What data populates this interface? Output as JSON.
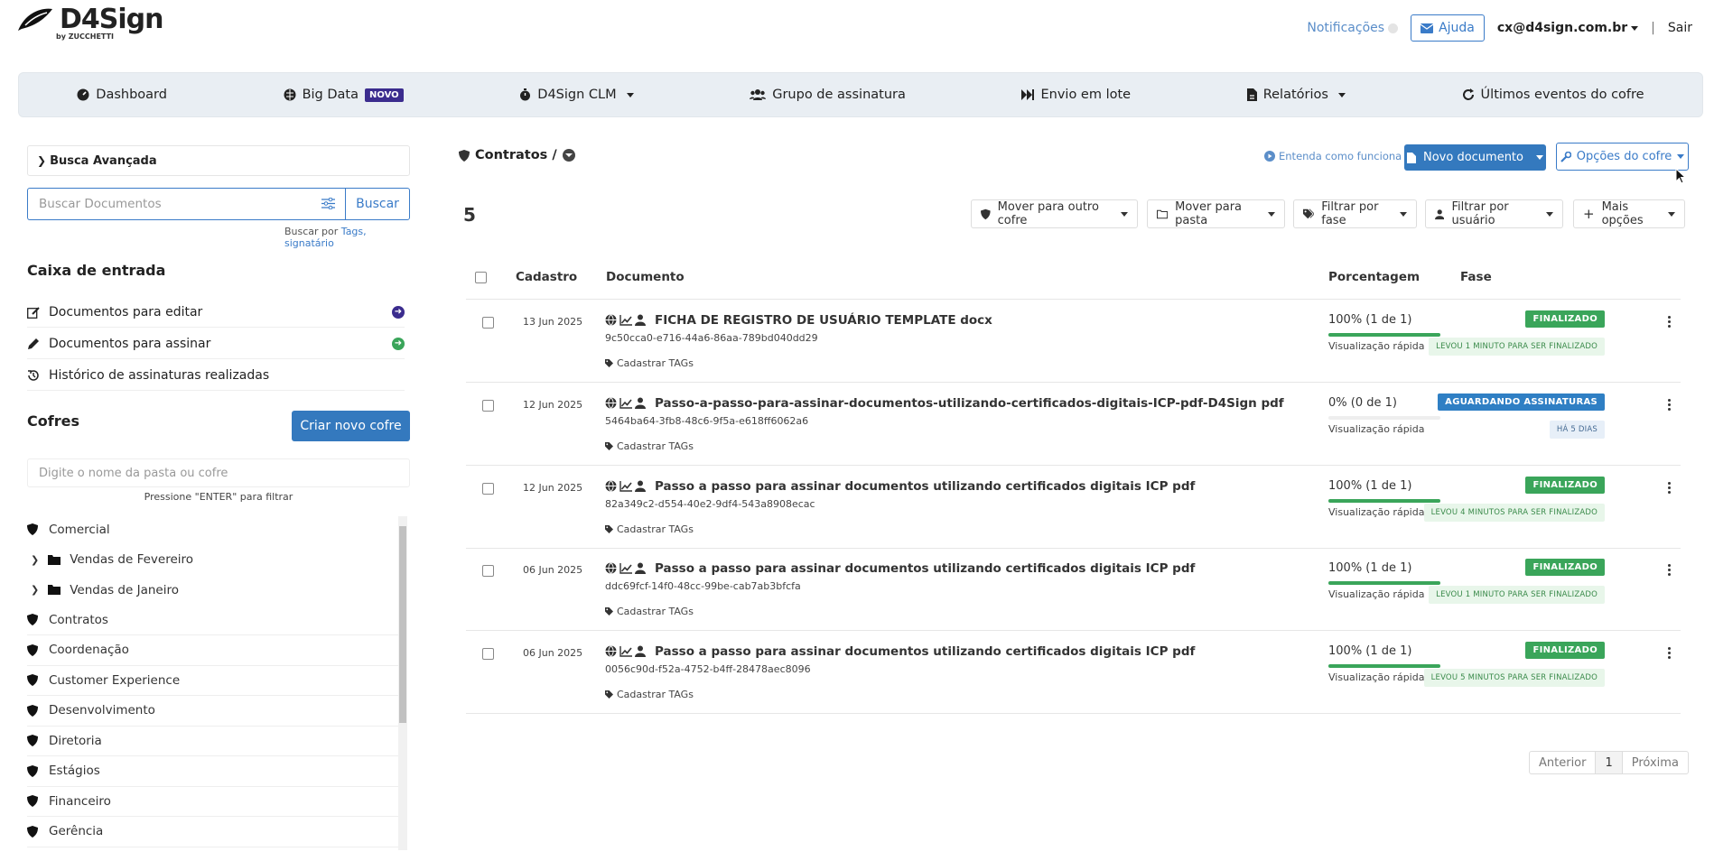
{
  "brand": {
    "name": "D4Sign",
    "sub": "by ZUCCHETTI"
  },
  "header": {
    "notifications_label": "Notificações",
    "help_label": "Ajuda",
    "user_email": "cx@d4sign.com.br",
    "separator": "|",
    "logout_label": "Sair"
  },
  "nav": {
    "items": [
      {
        "label": "Dashboard",
        "icon": "dashboard-icon"
      },
      {
        "label": "Big Data",
        "icon": "brain-icon",
        "badge": "NOVO"
      },
      {
        "label": "D4Sign CLM",
        "icon": "stopwatch-icon",
        "dropdown": true
      },
      {
        "label": "Grupo de assinatura",
        "icon": "users-icon"
      },
      {
        "label": "Envio em lote",
        "icon": "fast-forward-icon"
      },
      {
        "label": "Relatórios",
        "icon": "file-report-icon",
        "dropdown": true
      },
      {
        "label": "Últimos eventos do cofre",
        "icon": "refresh-icon"
      }
    ]
  },
  "sidebar": {
    "advanced_search_label": "Busca Avançada",
    "search_placeholder": "Buscar Documentos",
    "search_button": "Buscar",
    "search_hint_prefix": "Buscar por",
    "search_hint_links": "Tags, signatário",
    "inbox_title": "Caixa de entrada",
    "inbox_links": [
      {
        "label": "Documentos para editar",
        "icon": "edit-icon"
      },
      {
        "label": "Documentos para assinar",
        "icon": "pencil-icon"
      },
      {
        "label": "Histórico de assinaturas realizadas",
        "icon": "history-icon"
      }
    ],
    "vaults_title": "Cofres",
    "create_vault_button": "Criar novo cofre",
    "folder_filter_placeholder": "Digite o nome da pasta ou cofre",
    "folder_filter_hint": "Pressione \"ENTER\" para filtrar",
    "vaults": [
      {
        "label": "Comercial",
        "type": "vault"
      },
      {
        "label": "Vendas de Fevereiro",
        "type": "folder"
      },
      {
        "label": "Vendas de Janeiro",
        "type": "folder"
      },
      {
        "label": "Contratos",
        "type": "vault"
      },
      {
        "label": "Coordenação",
        "type": "vault"
      },
      {
        "label": "Customer Experience",
        "type": "vault"
      },
      {
        "label": "Desenvolvimento",
        "type": "vault"
      },
      {
        "label": "Diretoria",
        "type": "vault"
      },
      {
        "label": "Estágios",
        "type": "vault"
      },
      {
        "label": "Financeiro",
        "type": "vault"
      },
      {
        "label": "Gerência",
        "type": "vault"
      }
    ]
  },
  "main": {
    "breadcrumb": "Contratos /",
    "help_link": "Entenda como funciona",
    "new_document_button": "Novo documento",
    "vault_options_button": "Opções do cofre",
    "doc_count": "5",
    "toolbar": {
      "move_vault": "Mover para outro cofre",
      "move_folder": "Mover para pasta",
      "filter_phase": "Filtrar por fase",
      "filter_user": "Filtrar por usuário",
      "more_options": "Mais opções"
    },
    "columns": {
      "date": "Cadastro",
      "document": "Documento",
      "percent": "Porcentagem",
      "phase": "Fase"
    },
    "rows": [
      {
        "date": "13 Jun 2025",
        "title": "FICHA DE REGISTRO DE USUÁRIO TEMPLATE docx",
        "hash": "9c50cca0-e716-44a6-86aa-789bd040dd29",
        "tags": "Cadastrar TAGs",
        "percent_label": "100% (1 de 1)",
        "progress": 1.0,
        "preview": "Visualização rápida",
        "status": "FINALIZADO",
        "status_color": "#3aa55a",
        "note": "LEVOU 1 MINUTO PARA SER FINALIZADO",
        "note_bg": "#e8f6ea",
        "note_color": "#3a8a4a"
      },
      {
        "date": "12 Jun 2025",
        "title": "Passo-a-passo-para-assinar-documentos-utilizando-certificados-digitais-ICP-pdf-D4Sign pdf",
        "hash": "5464ba64-3fb8-48c6-9f5a-e618ff6062a6",
        "tags": "Cadastrar TAGs",
        "percent_label": "0% (0 de 1)",
        "progress": 0.0,
        "preview": "Visualização rápida",
        "status": "AGUARDANDO ASSINATURAS",
        "status_color": "#2f7fc4",
        "note": "HÁ 5 DIAS",
        "note_bg": "#e7eff8",
        "note_color": "#466b93"
      },
      {
        "date": "12 Jun 2025",
        "title": "Passo a passo para assinar documentos utilizando certificados digitais ICP pdf",
        "hash": "82a349c2-d554-40e2-9df4-543a8908ecac",
        "tags": "Cadastrar TAGs",
        "percent_label": "100% (1 de 1)",
        "progress": 1.0,
        "preview": "Visualização rápida",
        "status": "FINALIZADO",
        "status_color": "#3aa55a",
        "note": "LEVOU 4 MINUTOS PARA SER FINALIZADO",
        "note_bg": "#e8f6ea",
        "note_color": "#3a8a4a"
      },
      {
        "date": "06 Jun 2025",
        "title": "Passo a passo para assinar documentos utilizando certificados digitais ICP pdf",
        "hash": "ddc69fcf-14f0-48cc-99be-cab7ab3bfcfa",
        "tags": "Cadastrar TAGs",
        "percent_label": "100% (1 de 1)",
        "progress": 1.0,
        "preview": "Visualização rápida",
        "status": "FINALIZADO",
        "status_color": "#3aa55a",
        "note": "LEVOU 1 MINUTO PARA SER FINALIZADO",
        "note_bg": "#e8f6ea",
        "note_color": "#3a8a4a"
      },
      {
        "date": "06 Jun 2025",
        "title": "Passo a passo para assinar documentos utilizando certificados digitais ICP pdf",
        "hash": "0056c90d-f52a-4752-b4ff-28478aec8096",
        "tags": "Cadastrar TAGs",
        "percent_label": "100% (1 de 1)",
        "progress": 1.0,
        "preview": "Visualização rápida",
        "status": "FINALIZADO",
        "status_color": "#3aa55a",
        "note": "LEVOU 5 MINUTOS PARA SER FINALIZADO",
        "note_bg": "#e8f6ea",
        "note_color": "#3a8a4a"
      }
    ],
    "pagination": {
      "prev": "Anterior",
      "current": "1",
      "next": "Próxima"
    }
  }
}
